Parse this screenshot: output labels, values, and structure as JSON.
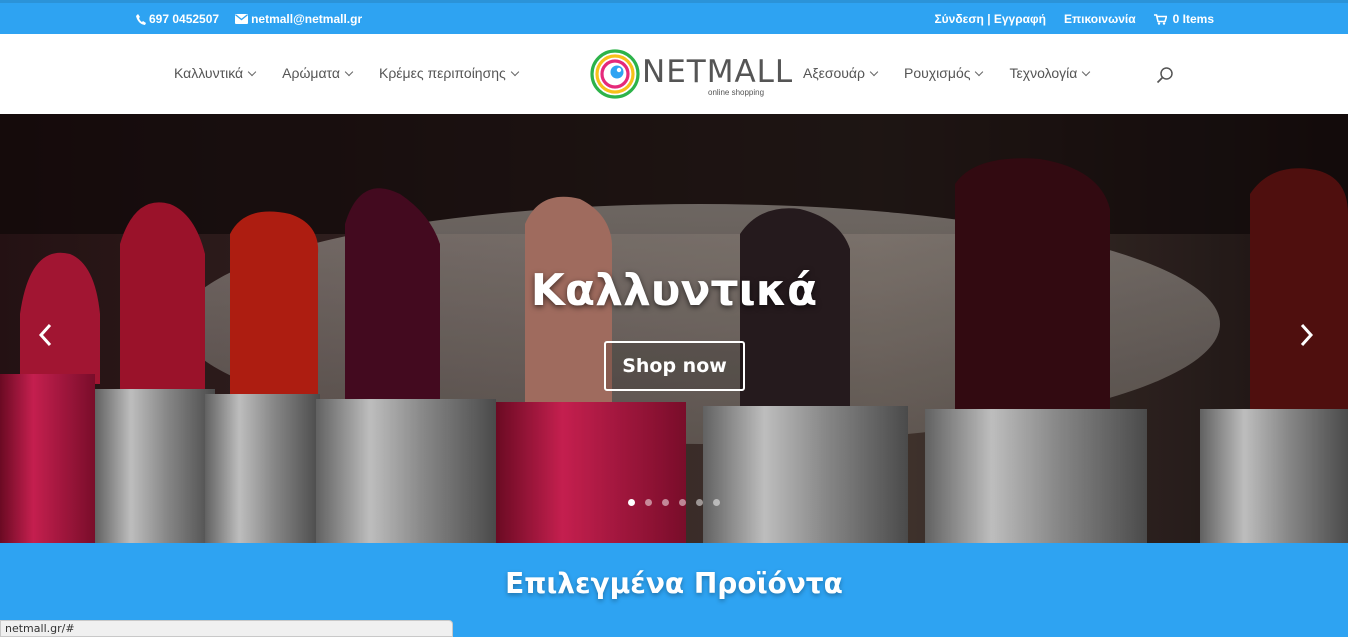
{
  "topbar": {
    "phone": "697 0452507",
    "email": "netmall@netmall.gr",
    "login": "Σύνδεση | Εγγραφή",
    "contact": "Επικοινωνία",
    "cart": "0 Items"
  },
  "logo": {
    "name": "NETMALL",
    "tagline": "online shopping"
  },
  "nav": {
    "left": [
      {
        "label": "Καλλυντικά"
      },
      {
        "label": "Αρώματα"
      },
      {
        "label": "Κρέμες περιποίησης"
      }
    ],
    "right": [
      {
        "label": "Αξεσουάρ"
      },
      {
        "label": "Ρουχισμός"
      },
      {
        "label": "Τεχνολογία"
      }
    ]
  },
  "hero": {
    "title": "Καλλυντικά",
    "button": "Shop now",
    "slide_count": 6,
    "active_slide": 1
  },
  "featured": {
    "title": "Επιλεγμένα Προϊόντα"
  },
  "status": {
    "url": "netmall.gr/#"
  },
  "colors": {
    "accent": "#2ea3f2",
    "text": "#555555"
  }
}
